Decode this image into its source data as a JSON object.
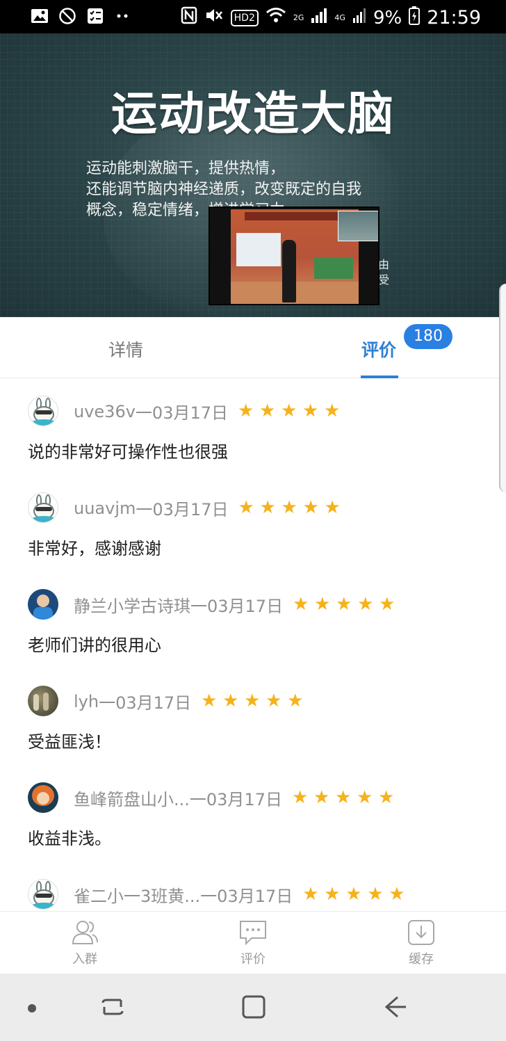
{
  "status_bar": {
    "network_badge": "HD2",
    "signal_2g": "2G",
    "signal_4g": "4G",
    "battery": "9%",
    "time": "21:59",
    "left_icons": [
      "gallery-icon",
      "blocked-icon",
      "checklist-icon",
      "more-dots-icon"
    ],
    "right_icons": [
      "nfc-icon",
      "mute-icon",
      "wifi-icon",
      "signal-icon",
      "battery-icon"
    ]
  },
  "banner": {
    "title": "运动改造大脑",
    "subtitle_lines": [
      "运动能刺激脑干，提供热情，",
      "还能调节脑内神经递质，改变既定的自我",
      "概念，稳定情绪，增进学习力"
    ],
    "edge_text_1": "由",
    "edge_text_2": "受"
  },
  "tabs": {
    "detail": "详情",
    "review": "评价",
    "review_count": "180",
    "active": "review"
  },
  "comments": [
    {
      "user": "uve36v",
      "sep": "一",
      "date": "03月17日",
      "rating": 5,
      "text": "说的非常好可操作性也很强",
      "avatar": "bunny"
    },
    {
      "user": "uuavjm",
      "sep": "一",
      "date": "03月17日",
      "rating": 5,
      "text": "非常好，感谢感谢",
      "avatar": "bunny"
    },
    {
      "user": "静兰小学古诗琪",
      "sep": "一",
      "date": "03月17日",
      "rating": 5,
      "text": "老师们讲的很用心",
      "avatar": "boy"
    },
    {
      "user": "lyh",
      "sep": "一",
      "date": "03月17日",
      "rating": 5,
      "text": "受益匪浅！",
      "avatar": "photo"
    },
    {
      "user": "鱼峰箭盘山小...",
      "sep": " 一",
      "date": "03月17日",
      "rating": 5,
      "text": "收益非浅。",
      "avatar": "cartoon"
    },
    {
      "user": "雀二小一3班黄...",
      "sep": " 一",
      "date": "03月17日",
      "rating": 5,
      "text": "",
      "avatar": "bunny"
    }
  ],
  "actions": {
    "join": "入群",
    "review": "评价",
    "cache": "缓存"
  },
  "colors": {
    "accent": "#2d7fd5",
    "badge": "#2a7fe3",
    "star": "#f5b21a",
    "muted": "#909090"
  }
}
